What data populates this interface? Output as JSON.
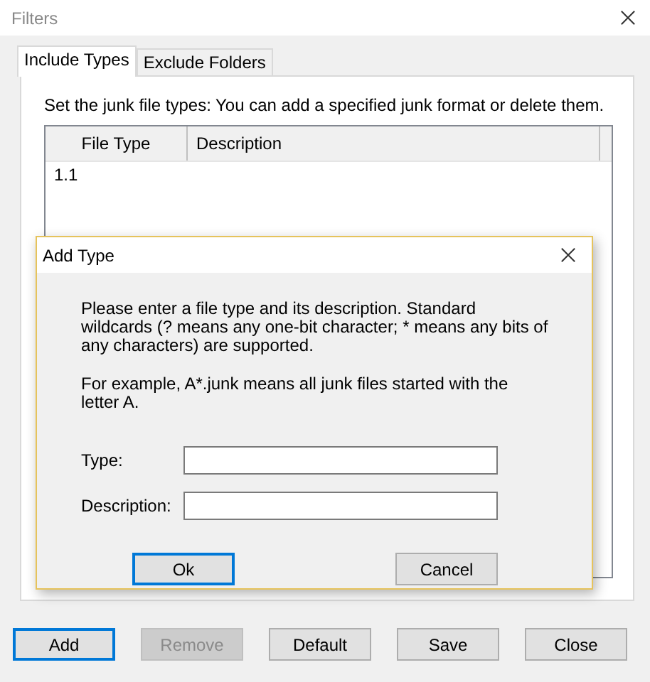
{
  "window": {
    "title": "Filters"
  },
  "tabs": [
    {
      "label": "Include Types",
      "selected": true
    },
    {
      "label": "Exclude Folders",
      "selected": false
    }
  ],
  "panel": {
    "instruction": "Set the junk file types: You can add a specified junk format or delete them.",
    "table": {
      "columns": [
        "File Type",
        "Description"
      ],
      "rows": [
        [
          "1.1",
          ""
        ]
      ]
    }
  },
  "buttons": [
    {
      "label": "Add",
      "default": true,
      "disabled": false
    },
    {
      "label": "Remove",
      "default": false,
      "disabled": true
    },
    {
      "label": "Default",
      "default": false,
      "disabled": false
    },
    {
      "label": "Save",
      "default": false,
      "disabled": false
    },
    {
      "label": "Close",
      "default": false,
      "disabled": false
    }
  ],
  "dialog": {
    "title": "Add Type",
    "message": "Please enter a file type and its description. Standard wildcards (? means any one-bit character; * means any bits of any characters) are supported.",
    "example": "For example, A*.junk means all junk files started with the letter A.",
    "fields": [
      {
        "label": "Type:"
      },
      {
        "label": "Description:"
      }
    ],
    "buttons": [
      {
        "label": "Ok",
        "default": true,
        "disabled": false
      },
      {
        "label": "Cancel",
        "default": false,
        "disabled": false
      }
    ]
  }
}
